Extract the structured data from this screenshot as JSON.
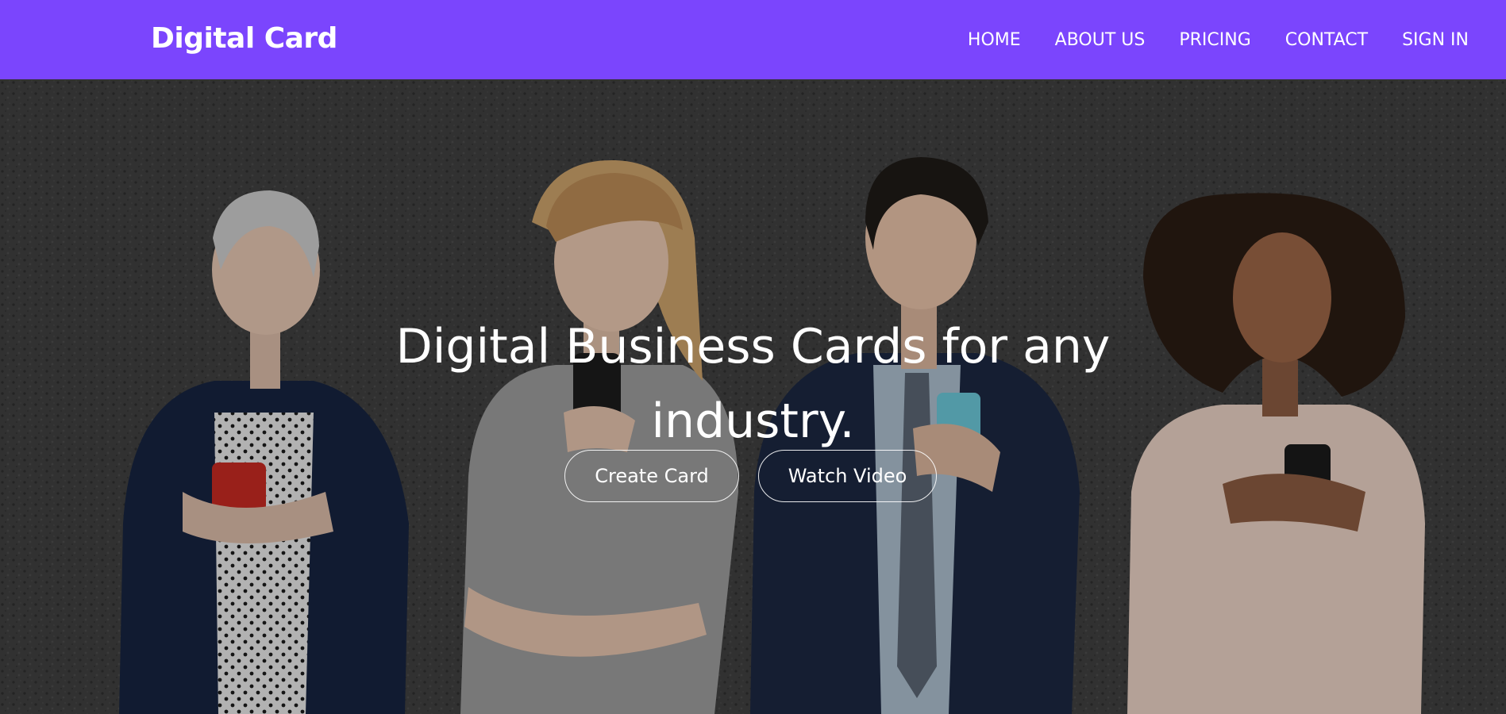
{
  "header": {
    "brand": "Digital Card",
    "nav": [
      "HOME",
      "ABOUT US",
      "PRICING",
      "CONTACT",
      "SIGN IN"
    ]
  },
  "hero": {
    "title_line1": "Digital Business Cards for any",
    "title_line2": "industry.",
    "buttons": {
      "create": "Create Card",
      "watch": "Watch Video"
    },
    "background_image": "four-people-using-smartphones"
  },
  "colors": {
    "navbar": "#7b45fd",
    "text": "#ffffff",
    "wall": "#3f3f3f"
  }
}
